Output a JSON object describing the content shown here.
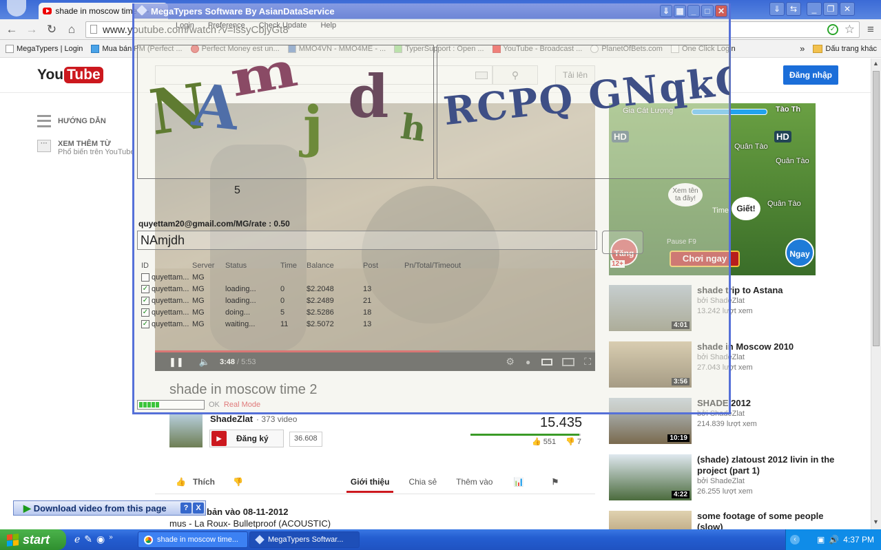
{
  "browser": {
    "tab_title": "shade in moscow time 2 - Yo",
    "url": "www.youtube.com/watch?v=lssyCbjyGt8",
    "bookmarks": [
      "MegaTypers | Login",
      "Mua bán PM (Perfect ...",
      "Perfect Money est un...",
      "MMO4VN - MMO4ME - ...",
      "TyperSupport : Open ...",
      "YouTube - Broadcast ...",
      "PlanetOfBets.com",
      "One Click Login"
    ],
    "bookmarks_more": "»",
    "bookmarks_folder": "Dấu trang khác"
  },
  "youtube": {
    "logo_you": "You",
    "logo_tube": "Tube",
    "upload_label": "Tải lên",
    "signin_label": "Đăng nhập",
    "guide_label": "HƯỚNG DẪN",
    "more_label": "XEM THÊM TỪ",
    "more_sub": "Phổ biến trên YouTube",
    "time_current": "3:48",
    "time_total": "5:53",
    "progress_fraction": 0.646,
    "video_title": "shade in moscow time 2",
    "channel_name": "ShadeZlat",
    "channel_videos": "373 video",
    "subscribe_label": "Đăng ký",
    "subscriber_count": "36.608",
    "view_count": "15.435",
    "like_count": "551",
    "dislike_count": "7",
    "like_fraction": 0.987,
    "like_label": "Thích",
    "tabs": [
      "Giới thiệu",
      "Chia sẻ",
      "Thêm vào"
    ],
    "published": "bản vào 08-11-2012",
    "description_line": "mus - La Roux- Bulletproof (ACOUSTIC)",
    "ad": {
      "name_left": "Gia Cát Lượng",
      "name_right": "Tào Th",
      "hd": "HD",
      "unit1": "Quân Tào",
      "unit2": "Quân Tào",
      "unit3": "Quân Tào",
      "bubble1": "Xem tên ta đây!",
      "bubble2": "Giết!",
      "time_label": "Time:",
      "pause_label": "Pause  F9",
      "play_btn": "Chơi ngay",
      "badge_left": "Tăng",
      "badge_right": "Ngay",
      "age": "12+"
    },
    "related": [
      {
        "title": "shade trip to Astana",
        "channel": "bởi ShadeZlat",
        "views": "13.242 lượt xem",
        "duration": "4:01"
      },
      {
        "title": "shade in Moscow 2010",
        "channel": "bởi ShadeZlat",
        "views": "27.043 lượt xem",
        "duration": "3:56"
      },
      {
        "title": "SHADE 2012",
        "channel": "bởi ShadeZlat",
        "views": "214.839 lượt xem",
        "duration": "10:19"
      },
      {
        "title": "(shade) zlatoust 2012 livin in the project (part 1)",
        "channel": "bởi ShadeZlat",
        "views": "26.255 lượt xem",
        "duration": "4:22"
      },
      {
        "title": "some footage of some people (slow)",
        "channel": "",
        "views": "",
        "duration": ""
      }
    ]
  },
  "megatypers": {
    "title": "MegaTypers Software By AsianDataService",
    "menu": [
      "Login",
      "Preference",
      "Check Update",
      "Help"
    ],
    "captcha_left": [
      "N",
      "A",
      "m",
      "j",
      "d",
      "h"
    ],
    "captcha_right": "RCPQ GNqkQ",
    "counter": "5",
    "account": "quyettam20@gmail.com/MG/rate : 0.50",
    "answer": "NAmjdh",
    "columns": [
      "ID",
      "Server",
      "Status",
      "Time",
      "Balance",
      "Post",
      "Pn/Total/Timeout"
    ],
    "rows": [
      {
        "checked": false,
        "id": "quyettam...",
        "server": "MG",
        "status": "",
        "time": "",
        "balance": "",
        "post": ""
      },
      {
        "checked": true,
        "id": "quyettam...",
        "server": "MG",
        "status": "loading...",
        "time": "0",
        "balance": "$2.2048",
        "post": "13"
      },
      {
        "checked": true,
        "id": "quyettam...",
        "server": "MG",
        "status": "loading...",
        "time": "0",
        "balance": "$2.2489",
        "post": "21"
      },
      {
        "checked": true,
        "id": "quyettam...",
        "server": "MG",
        "status": "doing...",
        "time": "5",
        "balance": "$2.5286",
        "post": "18"
      },
      {
        "checked": true,
        "id": "quyettam...",
        "server": "MG",
        "status": "waiting...",
        "time": "11",
        "balance": "$2.5072",
        "post": "13"
      }
    ],
    "status_ok": "OK",
    "status_mode": "Real Mode"
  },
  "download_bar": {
    "label": "Download video from this page",
    "help": "?",
    "close": "X"
  },
  "taskbar": {
    "start": "start",
    "tasks": [
      "shade in moscow time...",
      "MegaTypers Softwar..."
    ],
    "clock": "4:37 PM"
  },
  "colors": {
    "youtube_red": "#cc181e",
    "signin_blue": "#1b6ed9",
    "xp_blue": "#245ed1",
    "start_green": "#2f8f2f"
  }
}
